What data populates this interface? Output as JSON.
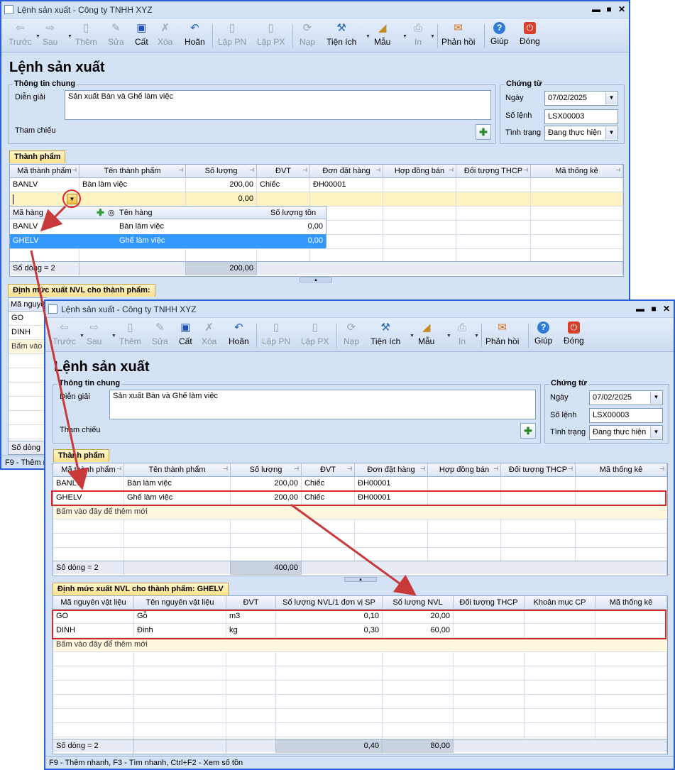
{
  "window_title": "Lệnh sản xuất - Công ty TNHH XYZ",
  "window_buttons": {
    "minimize": "▬",
    "maximize": "■",
    "close": "✕"
  },
  "toolbar": [
    {
      "label": "Trước",
      "icon": "arrow-left-icon",
      "glyph": "⇦",
      "enabled": false
    },
    {
      "label": "Sau",
      "icon": "arrow-right-icon",
      "glyph": "⇨",
      "enabled": false
    },
    {
      "label": "Thêm",
      "icon": "new-document-icon",
      "glyph": "▯",
      "enabled": false
    },
    {
      "label": "Sửa",
      "icon": "edit-document-icon",
      "glyph": "✎",
      "enabled": false
    },
    {
      "label": "Cất",
      "icon": "save-icon",
      "glyph": "💾",
      "enabled": true
    },
    {
      "label": "Xóa",
      "icon": "delete-icon",
      "glyph": "✗",
      "enabled": false
    },
    {
      "label": "Hoãn",
      "icon": "undo-icon",
      "glyph": "↶",
      "enabled": true
    },
    {
      "label": "Lập PN",
      "icon": "receipt-icon",
      "glyph": "▯",
      "enabled": false
    },
    {
      "label": "Lập PX",
      "icon": "issue-icon",
      "glyph": "▯",
      "enabled": false
    },
    {
      "label": "Nạp",
      "icon": "reload-icon",
      "glyph": "⟳",
      "enabled": false
    },
    {
      "label": "Tiện ích",
      "icon": "tools-icon",
      "glyph": "⚒",
      "enabled": true
    },
    {
      "label": "Mẫu",
      "icon": "template-icon",
      "glyph": "◢",
      "enabled": true
    },
    {
      "label": "In",
      "icon": "print-icon",
      "glyph": "⎙",
      "enabled": false
    },
    {
      "label": "Phản hồi",
      "icon": "feedback-mail-icon",
      "glyph": "✉",
      "enabled": true
    },
    {
      "label": "Giúp",
      "icon": "help-icon",
      "glyph": "?",
      "enabled": true
    },
    {
      "label": "Đóng",
      "icon": "close-power-icon",
      "glyph": "⏻",
      "enabled": true
    }
  ],
  "heading": "Lệnh sản xuất",
  "general": {
    "legend": "Thông tin chung",
    "description_label": "Diễn giải",
    "description_value": "Sản xuất Bàn và Ghế làm việc",
    "reference_label": "Tham chiếu"
  },
  "voucher": {
    "legend": "Chứng từ",
    "date_label": "Ngày",
    "date_value": "07/02/2025",
    "number_label": "Số lệnh",
    "number_value": "LSX00003",
    "status_label": "Tình trạng",
    "status_value": "Đang thực hiện"
  },
  "products_tab": "Thành phẩm",
  "products_columns": [
    "Mã thành phẩm",
    "Tên thành phẩm",
    "Số lượng",
    "ĐVT",
    "Đơn đặt hàng",
    "Hợp đồng bán",
    "Đối tượng THCP",
    "Mã thống kê"
  ],
  "products_w1_rows": [
    [
      "BANLV",
      "Bàn làm việc",
      "200,00",
      "Chiếc",
      "ĐH00001",
      "",
      "",
      ""
    ],
    [
      "",
      "",
      "0,00",
      "",
      "",
      "",
      "",
      ""
    ]
  ],
  "products_w2_rows": [
    [
      "BANLV",
      "Bàn làm việc",
      "200,00",
      "Chiếc",
      "ĐH00001",
      "",
      "",
      ""
    ],
    [
      "GHELV",
      "Ghế làm việc",
      "200,00",
      "Chiếc",
      "ĐH00001",
      "",
      "",
      ""
    ]
  ],
  "add_new_text": "Bấm vào đây để thêm mới",
  "products_w1_footer": {
    "count": "Số dòng = 2",
    "total": "200,00"
  },
  "products_w2_footer": {
    "count": "Số dòng = 2",
    "total": "400,00"
  },
  "lookup": {
    "columns": [
      "Mã hàng",
      "Tên hàng",
      "Số lượng tồn"
    ],
    "rows": [
      [
        "BANLV",
        "Bàn làm việc",
        "0,00"
      ],
      [
        "GHELV",
        "Ghế làm việc",
        "0,00"
      ]
    ]
  },
  "materials_w1_tab": "Định mức xuất NVL cho thành phẩm:",
  "materials_w2_tab": "Định mức xuất NVL cho thành phẩm: GHELV",
  "materials_columns": [
    "Mã nguyên vật liệu",
    "Tên nguyên vật liệu",
    "ĐVT",
    "Số lượng NVL/1 đơn vị SP",
    "Số lượng NVL",
    "Đối tượng THCP",
    "Khoản mục CP",
    "Mã thống kê"
  ],
  "materials_w1_first_col": "Mã nguyê",
  "materials_w1_rows": [
    "GO",
    "DINH",
    "Bấm vào đ"
  ],
  "materials_rows": [
    [
      "GO",
      "Gỗ",
      "m3",
      "0,10",
      "20,00",
      "",
      "",
      ""
    ],
    [
      "DINH",
      "Đinh",
      "kg",
      "0,30",
      "60,00",
      "",
      "",
      ""
    ]
  ],
  "materials_w1_footer_count": "Số dòng",
  "materials_footer": {
    "count": "Số dòng = 2",
    "per_unit_total": "0,40",
    "total": "80,00"
  },
  "status_w1": "F9 - Thêm n",
  "status_w2": "F9 - Thêm nhanh, F3 - Tìm nhanh, Ctrl+F2 - Xem số tồn",
  "colors": {
    "accent_red": "#d62a2a",
    "window_bg": "#d4e2f5",
    "selection": "#3399ff",
    "window_border": "#2a5dd9"
  }
}
